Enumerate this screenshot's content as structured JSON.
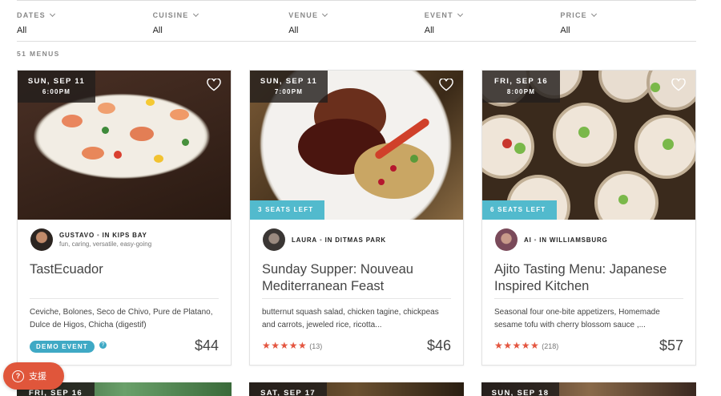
{
  "filters": [
    {
      "label": "DATES",
      "value": "All"
    },
    {
      "label": "CUISINE",
      "value": "All"
    },
    {
      "label": "VENUE",
      "value": "All"
    },
    {
      "label": "EVENT",
      "value": "All"
    },
    {
      "label": "PRICE",
      "value": "All"
    }
  ],
  "menu_count": "51 MENUS",
  "cards": [
    {
      "date": "SUN, SEP 11",
      "time": "6:00PM",
      "host_name": "GUSTAVO",
      "host_location": "IN KIPS BAY",
      "host_tags": "fun, caring, versatile, easy-going",
      "title": "TastEcuador",
      "description": "Ceviche, Bolones, Seco de Chivo, Pure de Platano, Dulce de Higos, Chicha (digestif)",
      "badge": "DEMO EVENT",
      "badge_help": "?",
      "price": "$44"
    },
    {
      "date": "SUN, SEP 11",
      "time": "7:00PM",
      "seats_left": "3 SEATS LEFT",
      "host_name": "LAURA",
      "host_location": "IN DITMAS PARK",
      "title": "Sunday Supper: Nouveau Mediterranean Feast",
      "description": "butternut squash salad, chicken tagine, chickpeas and carrots, jeweled rice, ricotta...",
      "stars": "★★★★★",
      "rating_count": "(13)",
      "rating": 5,
      "price": "$46"
    },
    {
      "date": "FRI, SEP 16",
      "time": "8:00PM",
      "seats_left": "6 SEATS LEFT",
      "host_name": "AI",
      "host_location": "IN WILLIAMSBURG",
      "title": "Ajito Tasting Menu: Japanese Inspired Kitchen",
      "description": "Seasonal four one-bite appetizers, Homemade sesame tofu with cherry blossom sauce ,...",
      "stars": "★★★★★",
      "rating_count": "(218)",
      "rating": 5,
      "price": "$57"
    }
  ],
  "next_row_dates": [
    "FRI, SEP 16",
    "SAT, SEP 17",
    "SUN, SEP 18"
  ],
  "support": {
    "icon": "?",
    "label": "支援"
  },
  "colors": {
    "accent": "#52bacd",
    "stars": "#e4553f",
    "support": "#e0563b"
  }
}
